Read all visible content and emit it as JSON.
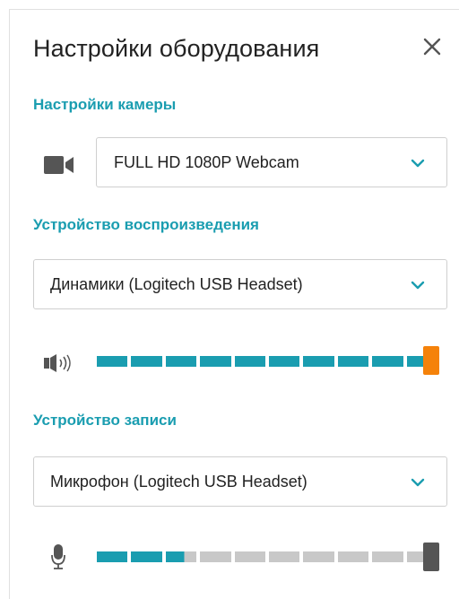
{
  "dialog": {
    "title": "Настройки оборудования"
  },
  "camera": {
    "section_label": "Настройки камеры",
    "device": "FULL HD 1080P Webcam",
    "icon": "camera-icon"
  },
  "playback": {
    "section_label": "Устройство воспроизведения",
    "device": "Динамики (Logitech USB Headset)",
    "icon": "speaker-icon",
    "level_segments": 10,
    "level_active_segments": 10,
    "active_color": "#1a9db0",
    "knob_color": "#f5820a",
    "volume": 1.0
  },
  "recording": {
    "section_label": "Устройство записи",
    "device": "Микрофон (Logitech USB Headset)",
    "icon": "microphone-icon",
    "level_segments": 10,
    "level_active_segments": 2.6,
    "active_color": "#1a9db0",
    "inactive_color": "#c8c8c8",
    "knob_color": "#555555",
    "volume": 1.0
  },
  "colors": {
    "accent": "#1a9db0",
    "title": "#222222"
  }
}
